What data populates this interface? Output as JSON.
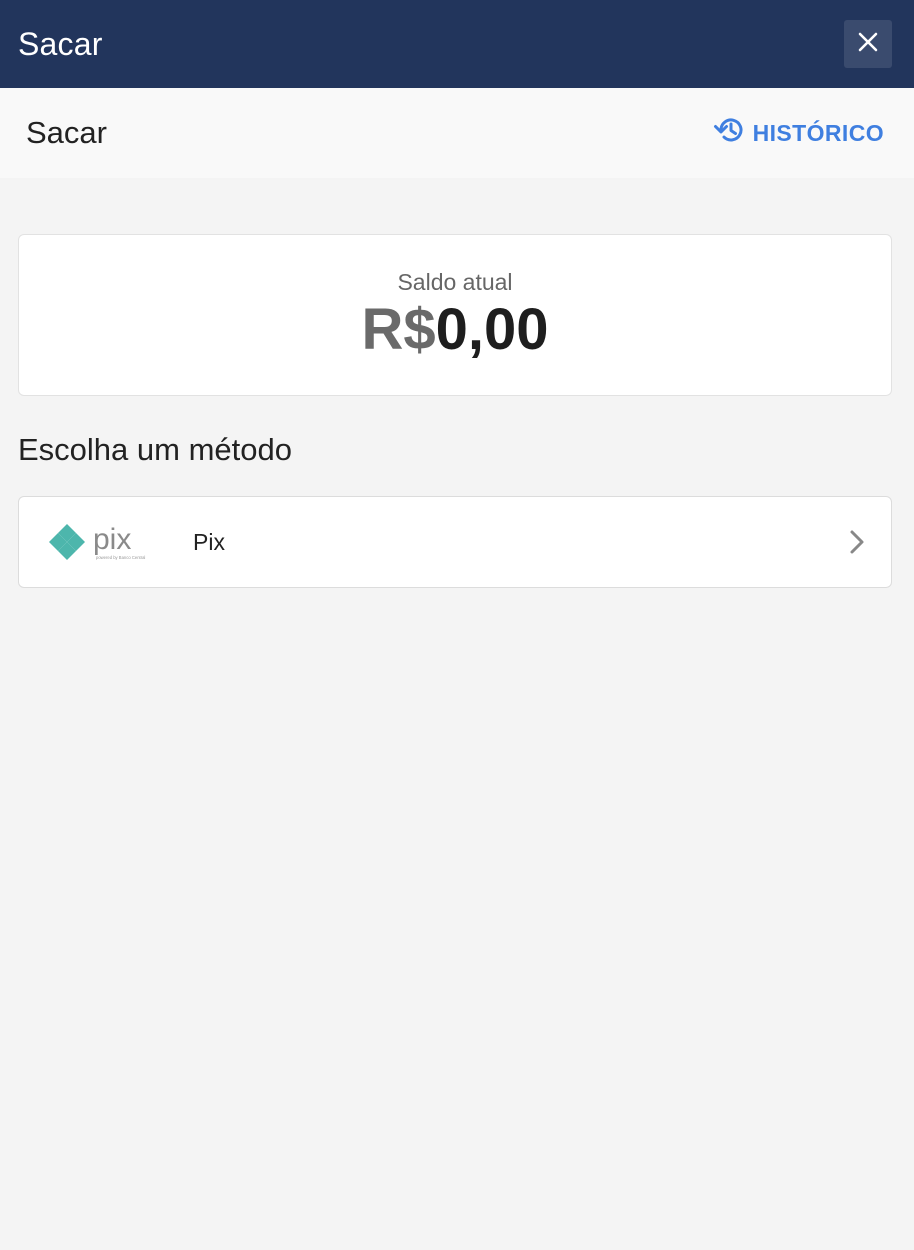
{
  "topbar": {
    "title": "Sacar",
    "close_icon": "close-icon"
  },
  "subheader": {
    "title": "Sacar",
    "history_label": "HISTÓRICO",
    "history_icon": "history-icon"
  },
  "balance": {
    "label": "Saldo atual",
    "currency": "R$",
    "amount": "0,00"
  },
  "methods": {
    "section_title": "Escolha um método",
    "items": [
      {
        "label": "Pix",
        "logo_text": "pix",
        "logo_tagline": "powered by Banco Central",
        "icon": "pix-logo",
        "arrow_icon": "chevron-right-icon"
      }
    ]
  },
  "colors": {
    "topbar_bg": "#22355c",
    "accent": "#3f7fe0",
    "pix_teal": "#4db6ac",
    "page_bg": "#f4f4f4"
  }
}
